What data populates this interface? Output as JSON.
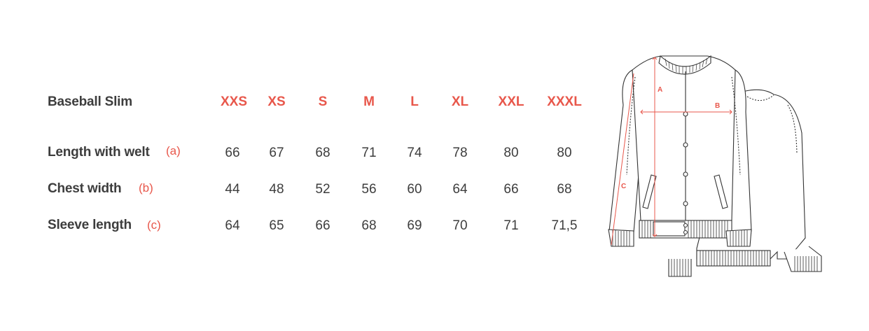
{
  "table": {
    "title": "Baseball Slim",
    "sizes": [
      "XXS",
      "XS",
      "S",
      "M",
      "L",
      "XL",
      "XXL",
      "XXXL"
    ],
    "rows": [
      {
        "label": "Length with welt",
        "code": "(a)",
        "values": [
          "66",
          "67",
          "68",
          "71",
          "74",
          "78",
          "80",
          "80"
        ]
      },
      {
        "label": "Chest width",
        "code": "(b)",
        "values": [
          "44",
          "48",
          "52",
          "56",
          "60",
          "64",
          "66",
          "68"
        ]
      },
      {
        "label": "Sleeve length",
        "code": "(c)",
        "values": [
          "64",
          "65",
          "66",
          "68",
          "69",
          "70",
          "71",
          "71,5"
        ]
      }
    ]
  },
  "diagram": {
    "label_a": "A",
    "label_b": "B",
    "label_c": "C",
    "measure_color": "#e8574b",
    "line_color": "#333333"
  },
  "colors": {
    "accent": "#e8574b",
    "text": "#3d3d3d"
  }
}
